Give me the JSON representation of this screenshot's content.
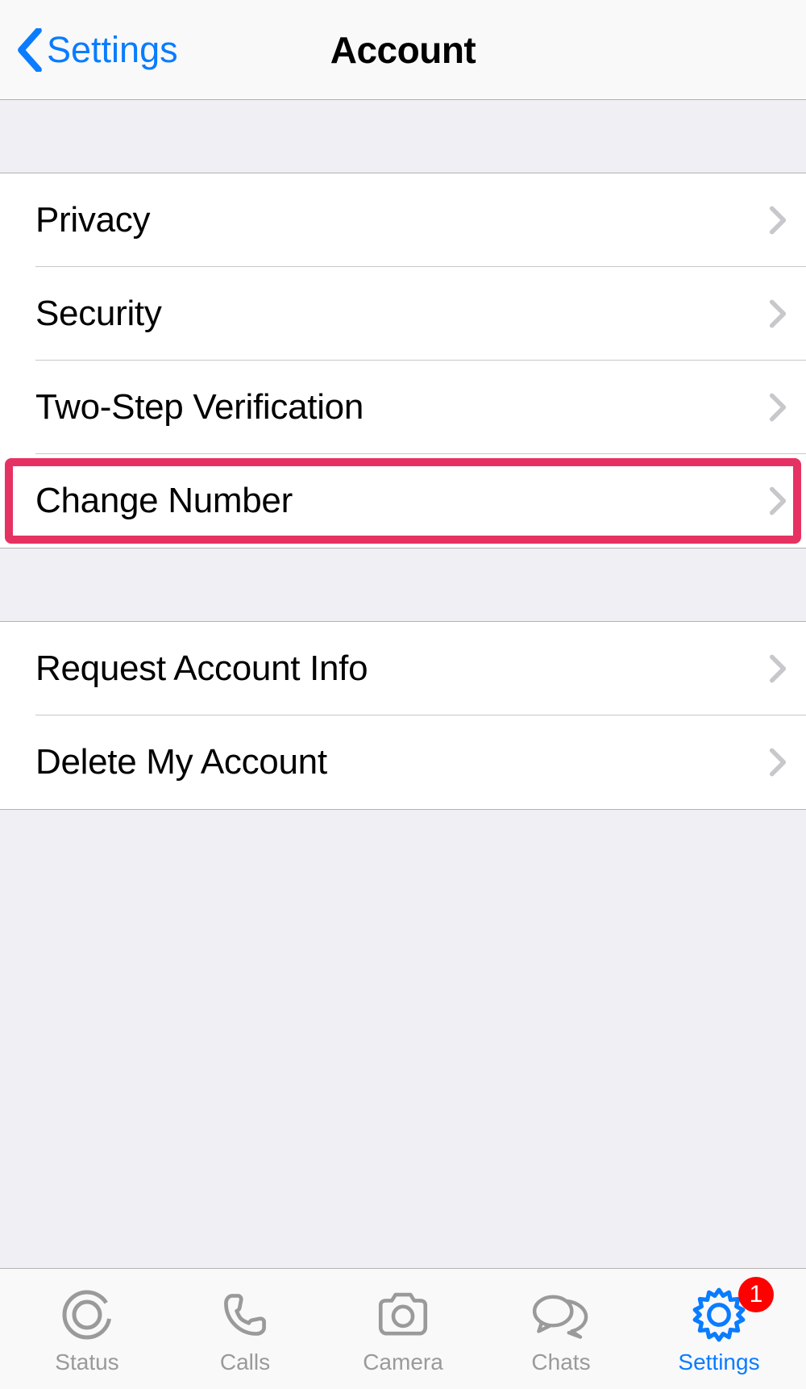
{
  "navbar": {
    "back_label": "Settings",
    "title": "Account"
  },
  "groups": [
    {
      "rows": [
        {
          "label": "Privacy"
        },
        {
          "label": "Security"
        },
        {
          "label": "Two-Step Verification"
        },
        {
          "label": "Change Number",
          "highlighted": true
        }
      ]
    },
    {
      "rows": [
        {
          "label": "Request Account Info"
        },
        {
          "label": "Delete My Account"
        }
      ]
    }
  ],
  "tabs": {
    "items": [
      {
        "label": "Status",
        "icon": "status-icon"
      },
      {
        "label": "Calls",
        "icon": "phone-icon"
      },
      {
        "label": "Camera",
        "icon": "camera-icon"
      },
      {
        "label": "Chats",
        "icon": "chats-icon"
      },
      {
        "label": "Settings",
        "icon": "gear-icon",
        "active": true,
        "badge": "1"
      }
    ]
  },
  "colors": {
    "accent": "#0a7cff",
    "highlight_border": "#e63262",
    "badge": "#ff0000",
    "inactive": "#9a9a9a"
  }
}
